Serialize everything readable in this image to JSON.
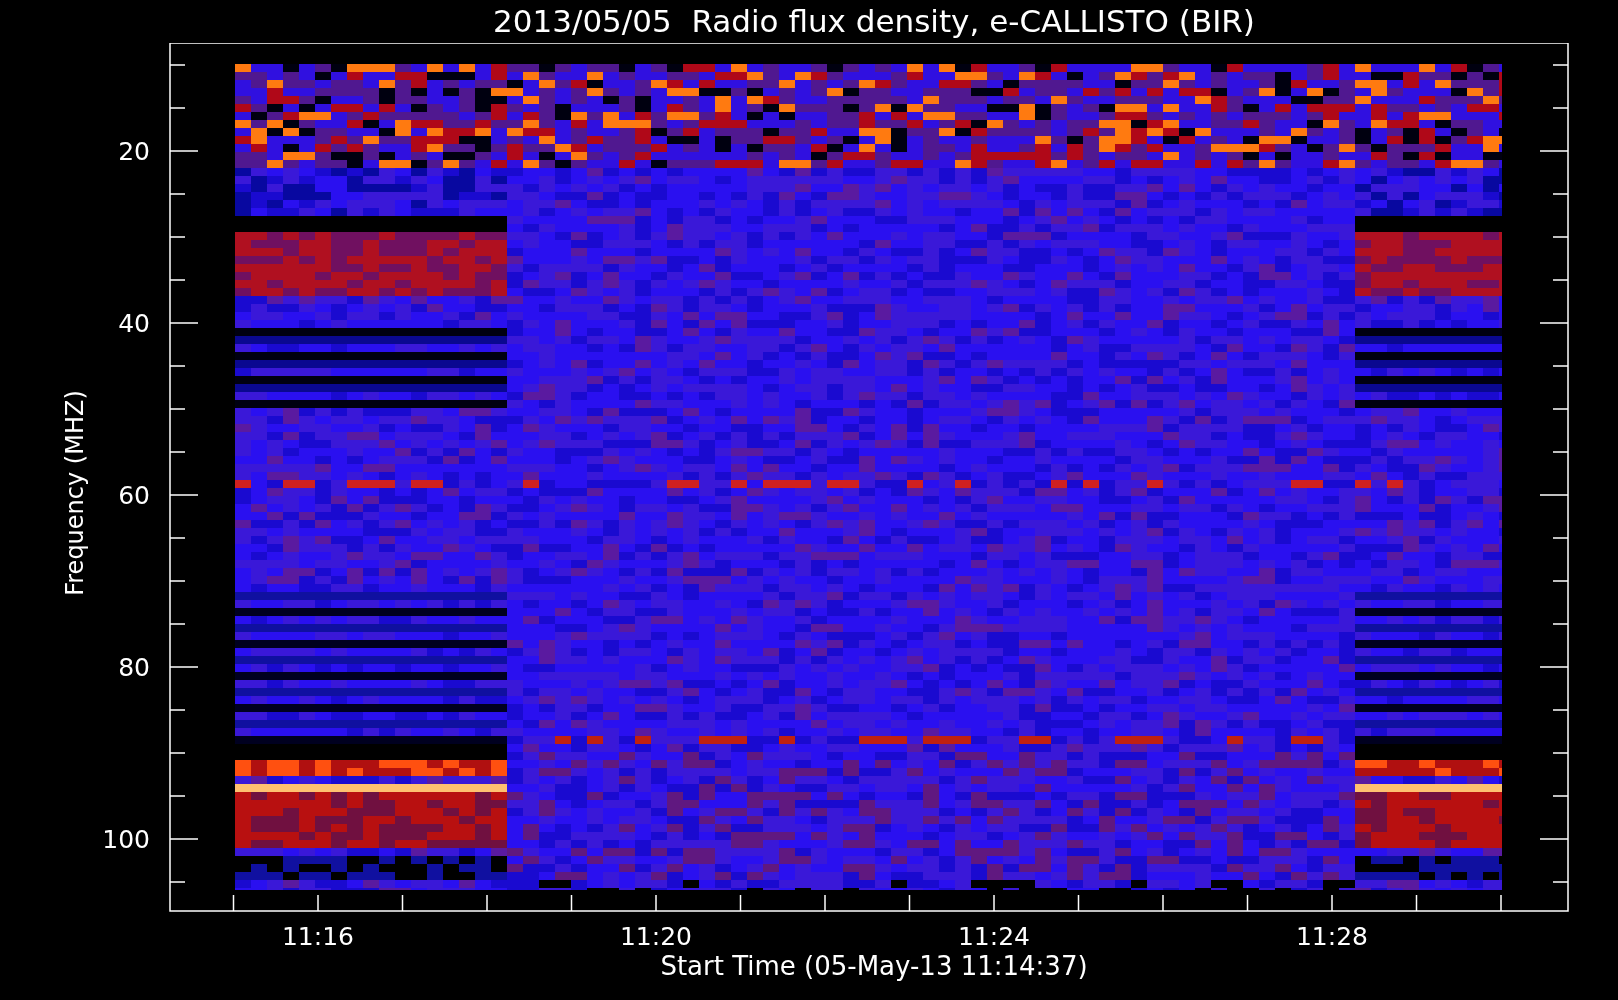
{
  "title": "2013/05/05  Radio flux density, e-CALLISTO (BIR)",
  "y_axis": {
    "label": "Frequency (MHZ)",
    "ticks": [
      "20",
      "40",
      "60",
      "80",
      "100"
    ]
  },
  "x_axis": {
    "label": "Start Time (05-May-13 11:14:37)",
    "ticks": [
      "11:16",
      "11:20",
      "11:24",
      "11:28"
    ]
  }
}
